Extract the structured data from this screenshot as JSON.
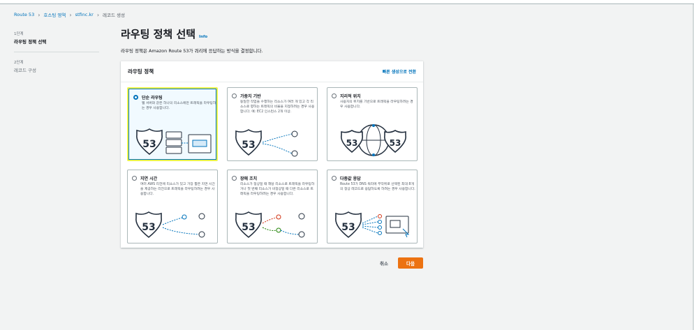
{
  "breadcrumb": {
    "items": [
      "Route 53",
      "호스팅 영역",
      "stfinc.kr"
    ],
    "current": "레코드 생성"
  },
  "steps": [
    {
      "num": "1단계",
      "label": "라우팅 정책 선택",
      "active": true
    },
    {
      "num": "2단계",
      "label": "레코드 구성",
      "active": false
    }
  ],
  "page": {
    "title": "라우팅 정책 선택",
    "info": "Info",
    "description": "라우팅 정책은 Amazon Route 53가 쿼리에 응답하는 방식을 결정합니다."
  },
  "panel": {
    "title": "라우팅 정책",
    "quick_link": "빠른 생성으로 전환"
  },
  "policies": [
    {
      "name": "단순 라우팅",
      "desc": "웹 서버와 같은 하나의 리소스에만 트래픽을 라우팅하는 경우 사용합니다.",
      "selected": true,
      "icon": "simple-routing-illustration"
    },
    {
      "name": "가중치 기반",
      "desc": "동일한 작업을 수행하는 리소스가 여러 개 있고 각 리소스로 향하는 트래픽의 비율을 지정하려는 경우 사용합니다. 예: EC2 인스턴스 2개 이상.",
      "selected": false,
      "icon": "weighted-routing-illustration"
    },
    {
      "name": "지리적 위치",
      "desc": "사용자의 위치를 기반으로 트래픽을 라우팅하려는 경우 사용합니다.",
      "selected": false,
      "icon": "geolocation-illustration"
    },
    {
      "name": "지연 시간",
      "desc": "여러 AWS 리전에 리소스가 있고 가장 짧은 지연 시간을 제공하는 리전으로 트래픽을 라우팅하려는 경우 사용합니다.",
      "selected": false,
      "icon": "latency-illustration"
    },
    {
      "name": "장애 조치",
      "desc": "리소스가 정상일 때 해당 리소스로 트래픽을 라우팅하거나 첫 번째 리소스가 비정상일 때 다른 리소스로 트래픽을 라우팅하려는 경우 사용합니다.",
      "selected": false,
      "icon": "failover-illustration"
    },
    {
      "name": "다중값 응답",
      "desc": "Route 53가 DNS 쿼리에 무작위로 선택된 최대 8개의 정상 레코드로 응답하도록 하려는 경우 사용합니다.",
      "selected": false,
      "icon": "multivalue-illustration"
    }
  ],
  "badge_text": "53",
  "footer": {
    "cancel": "취소",
    "next": "다음"
  },
  "colors": {
    "link": "#0073bb",
    "primary": "#ec7211",
    "selected_border": "#ecf44b"
  }
}
